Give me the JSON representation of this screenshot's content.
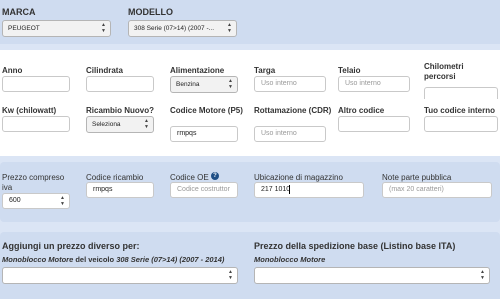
{
  "top": {
    "marca_label": "MARCA",
    "marca_value": "PEUGEOT",
    "modello_label": "MODELLO",
    "modello_value": "308 Serie (07>14) (2007 -..."
  },
  "row1": {
    "anno_label": "Anno",
    "cilindrata_label": "Cilindrata",
    "alimentazione_label": "Alimentazione",
    "alimentazione_value": "Benzina",
    "targa_label": "Targa",
    "targa_placeholder": "Uso interno",
    "telaio_label": "Telaio",
    "telaio_placeholder": "Uso interno",
    "chilometri_label": "Chilometri percorsi"
  },
  "row2": {
    "kw_label": "Kw (chilowatt)",
    "ricambio_label": "Ricambio Nuovo?",
    "ricambio_value": "Seleziona",
    "codice_motore_label": "Codice Motore (P5)",
    "codice_motore_value": "rmpqs",
    "rottamazione_label": "Rottamazione (CDR)",
    "rottamazione_placeholder": "Uso interno",
    "altro_codice_label": "Altro codice",
    "tuo_codice_label": "Tuo codice interno"
  },
  "row3": {
    "prezzo_label": "Prezzo compreso iva",
    "prezzo_value": "600",
    "codice_ricambio_label": "Codice ricambio",
    "codice_ricambio_value": "rmpqs",
    "codice_oe_label": "Codice OE",
    "codice_oe_placeholder": "Codice costruttor",
    "help_icon": "?",
    "ubicazione_label": "Ubicazione di magazzino",
    "ubicazione_value": "217 1010",
    "note_label": "Note parte pubblica",
    "note_placeholder": "(max 20 caratteri)"
  },
  "row4": {
    "aggiungi_title": "Aggiungi un prezzo diverso per:",
    "aggiungi_part": "Monoblocco Motore",
    "aggiungi_mid": " del veicolo ",
    "aggiungi_vehicle": "308 Serie (07>14) (2007 - 2014)",
    "spedizione_title": "Prezzo della spedizione base (Listino base ITA)",
    "spedizione_sub": "Monoblocco Motore"
  }
}
